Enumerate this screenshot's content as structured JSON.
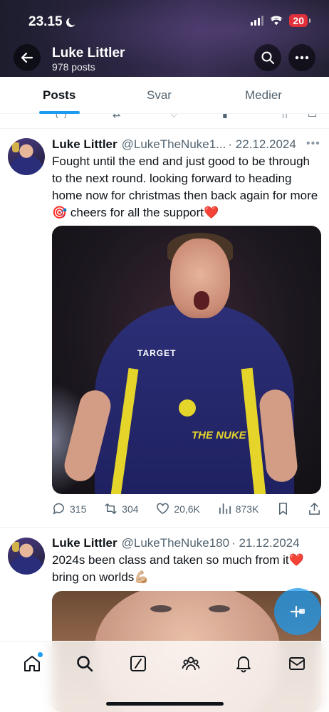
{
  "status_bar": {
    "time": "23.15",
    "battery": "20"
  },
  "header": {
    "name": "Luke Littler",
    "posts_count": "978 posts"
  },
  "tabs": [
    {
      "label": "Posts",
      "active": true
    },
    {
      "label": "Svar",
      "active": false
    },
    {
      "label": "Medier",
      "active": false
    }
  ],
  "posts": [
    {
      "name": "Luke Littler",
      "handle": "@LukeTheNuke1...",
      "date": "· 22.12.2024",
      "text": "Fought until the end and just good to be through to the next round. looking forward to heading home now for christmas then back again for more🎯 cheers for all the support❤️",
      "media_text": {
        "shirt_brand": "TARGET",
        "shirt_name": "THE NUKE"
      },
      "stats": {
        "replies": "315",
        "reposts": "304",
        "likes": "20,6K",
        "views": "873K"
      }
    },
    {
      "name": "Luke Littler",
      "handle": "@LukeTheNuke180",
      "date": "· 21.12.2024",
      "text": "2024s been class and taken so much from it❤️ bring on worlds💪🏼"
    }
  ],
  "icons": {
    "back": "arrow-left-icon",
    "search": "search-icon",
    "more": "more-icon",
    "nav": [
      "home-icon",
      "search-icon",
      "grok-icon",
      "communities-icon",
      "notifications-icon",
      "messages-icon"
    ]
  },
  "colors": {
    "accent": "#1d9bf0",
    "text": "#0f1419",
    "secondary": "#536471"
  }
}
